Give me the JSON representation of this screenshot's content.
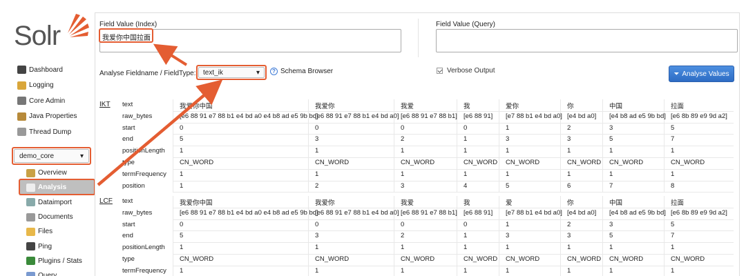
{
  "logo": {
    "text": "Solr"
  },
  "nav": [
    {
      "label": "Dashboard",
      "icon": "dashboard-icon"
    },
    {
      "label": "Logging",
      "icon": "logging-icon"
    },
    {
      "label": "Core Admin",
      "icon": "core-admin-icon"
    },
    {
      "label": "Java Properties",
      "icon": "java-icon"
    },
    {
      "label": "Thread Dump",
      "icon": "thread-dump-icon"
    }
  ],
  "core_selector": {
    "value": "demo_core"
  },
  "core_nav": [
    {
      "label": "Overview",
      "icon": "overview-icon"
    },
    {
      "label": "Analysis",
      "icon": "analysis-icon",
      "active": true
    },
    {
      "label": "Dataimport",
      "icon": "dataimport-icon"
    },
    {
      "label": "Documents",
      "icon": "documents-icon"
    },
    {
      "label": "Files",
      "icon": "files-icon"
    },
    {
      "label": "Ping",
      "icon": "ping-icon"
    },
    {
      "label": "Plugins / Stats",
      "icon": "plugins-icon"
    },
    {
      "label": "Query",
      "icon": "query-icon"
    }
  ],
  "field_value_index": {
    "label": "Field Value (Index)",
    "value": "我爱你中国拉面"
  },
  "field_value_query": {
    "label": "Field Value (Query)",
    "value": ""
  },
  "fieldtype": {
    "label": "Analyse Fieldname / FieldType:",
    "value": "text_ik"
  },
  "schema_browser": {
    "label": "Schema Browser"
  },
  "verbose": {
    "label": "Verbose Output",
    "checked": true
  },
  "analyse_button": {
    "label": "Analyse Values"
  },
  "row_labels": [
    "text",
    "raw_bytes",
    "start",
    "end",
    "positionLength",
    "type",
    "termFrequency",
    "position"
  ],
  "groups": [
    {
      "name": "IKT",
      "tokens": [
        [
          "我爱你中国",
          "[e6 88 91 e7 88 b1 e4 bd a0 e4 b8 ad e5 9b bd]",
          "0",
          "5",
          "1",
          "CN_WORD",
          "1",
          "1"
        ],
        [
          "我爱你",
          "[e6 88 91 e7 88 b1 e4 bd a0]",
          "0",
          "3",
          "1",
          "CN_WORD",
          "1",
          "2"
        ],
        [
          "我爱",
          "[e6 88 91 e7 88 b1]",
          "0",
          "2",
          "1",
          "CN_WORD",
          "1",
          "3"
        ],
        [
          "我",
          "[e6 88 91]",
          "0",
          "1",
          "1",
          "CN_WORD",
          "1",
          "4"
        ],
        [
          "爱你",
          "[e7 88 b1 e4 bd a0]",
          "1",
          "3",
          "1",
          "CN_WORD",
          "1",
          "5"
        ],
        [
          "你",
          "[e4 bd a0]",
          "2",
          "3",
          "1",
          "CN_WORD",
          "1",
          "6"
        ],
        [
          "中国",
          "[e4 b8 ad e5 9b bd]",
          "3",
          "5",
          "1",
          "CN_WORD",
          "1",
          "7"
        ],
        [
          "拉面",
          "[e6 8b 89 e9 9d a2]",
          "5",
          "7",
          "1",
          "CN_WORD",
          "1",
          "8"
        ]
      ]
    },
    {
      "name": "LCF",
      "tokens": [
        [
          "我爱你中国",
          "[e6 88 91 e7 88 b1 e4 bd a0 e4 b8 ad e5 9b bd]",
          "0",
          "5",
          "1",
          "CN_WORD",
          "1",
          ""
        ],
        [
          "我爱你",
          "[e6 88 91 e7 88 b1 e4 bd a0]",
          "0",
          "3",
          "1",
          "CN_WORD",
          "1",
          ""
        ],
        [
          "我爱",
          "[e6 88 91 e7 88 b1]",
          "0",
          "2",
          "1",
          "CN_WORD",
          "1",
          ""
        ],
        [
          "我",
          "[e6 88 91]",
          "0",
          "1",
          "1",
          "CN_WORD",
          "1",
          ""
        ],
        [
          "爱",
          "[e7 88 b1 e4 bd a0]",
          "1",
          "3",
          "1",
          "CN_WORD",
          "1",
          ""
        ],
        [
          "你",
          "[e4 bd a0]",
          "2",
          "3",
          "1",
          "CN_WORD",
          "1",
          ""
        ],
        [
          "中国",
          "[e4 b8 ad e5 9b bd]",
          "3",
          "5",
          "1",
          "CN_WORD",
          "1",
          ""
        ],
        [
          "拉面",
          "[e6 8b 89 e9 9d a2]",
          "5",
          "7",
          "1",
          "CN_WORD",
          "1",
          ""
        ]
      ]
    }
  ],
  "colors": {
    "accent_red": "#e45d32",
    "button_blue": "#2d6cc4"
  }
}
